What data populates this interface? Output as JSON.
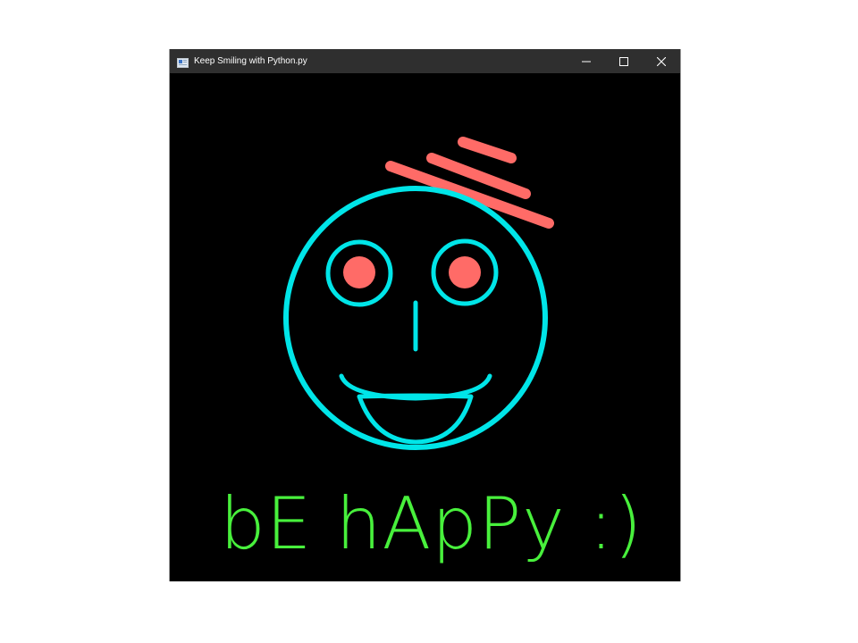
{
  "window": {
    "title": "Keep Smiling with Python.py",
    "controls": {
      "minimize_icon": "minimize-icon",
      "maximize_icon": "maximize-icon",
      "close_icon": "close-icon"
    }
  },
  "canvas": {
    "background": "#000000",
    "face_color": "#00e5e8",
    "eye_color": "#ff6b67",
    "hat_color": "#ff6b67",
    "text_color": "#48f03c",
    "text": "bE hApPy :)"
  }
}
